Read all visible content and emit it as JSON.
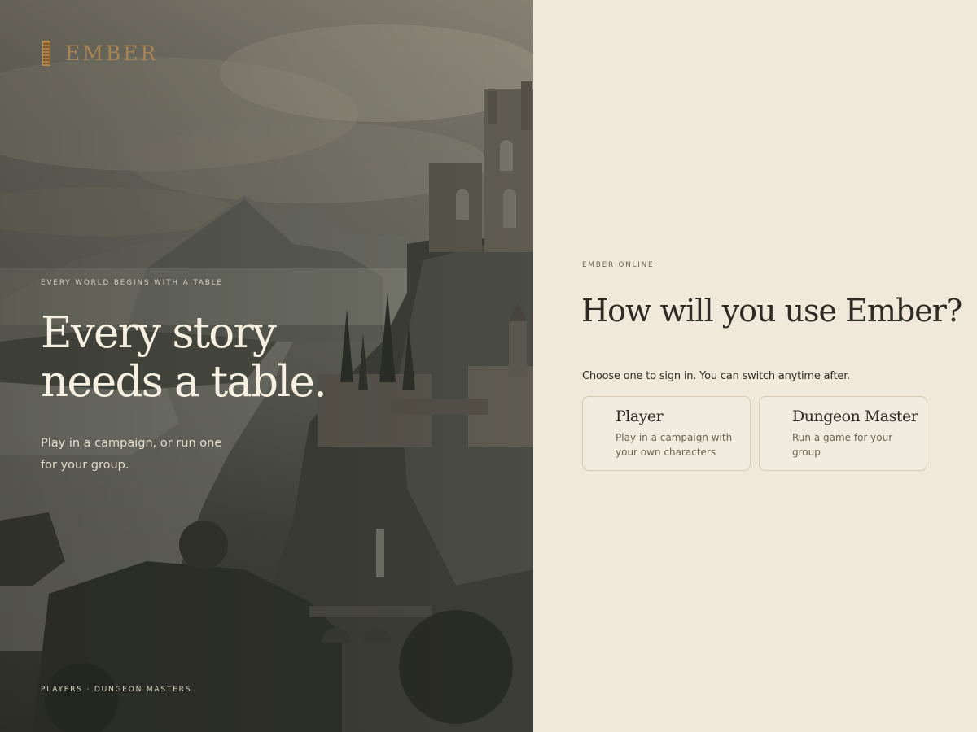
{
  "brand": {
    "name": "EMBER",
    "mark_icon": "book-spine-icon",
    "accent": "#a88454"
  },
  "hero": {
    "eyebrow": "EVERY WORLD BEGINS WITH A TABLE",
    "headline": "Every story needs a table.",
    "subtext": "Play in a campaign, or run one for your group.",
    "footer": "PLAYERS · DUNGEON MASTERS",
    "image": "castle-landscape-painting"
  },
  "signin": {
    "kicker": "EMBER ONLINE",
    "title": "How will you use Ember?",
    "instruction": "Choose one to sign in. You can switch anytime after.",
    "roles": [
      {
        "name": "Player",
        "description": "Play in a campaign with your own characters"
      },
      {
        "name": "Dungeon Master",
        "description": "Run a game for your group"
      }
    ]
  },
  "colors": {
    "panel_bg": "#f0e8da",
    "text_dark": "#2f2a23",
    "card_border": "#d7cbb8"
  }
}
